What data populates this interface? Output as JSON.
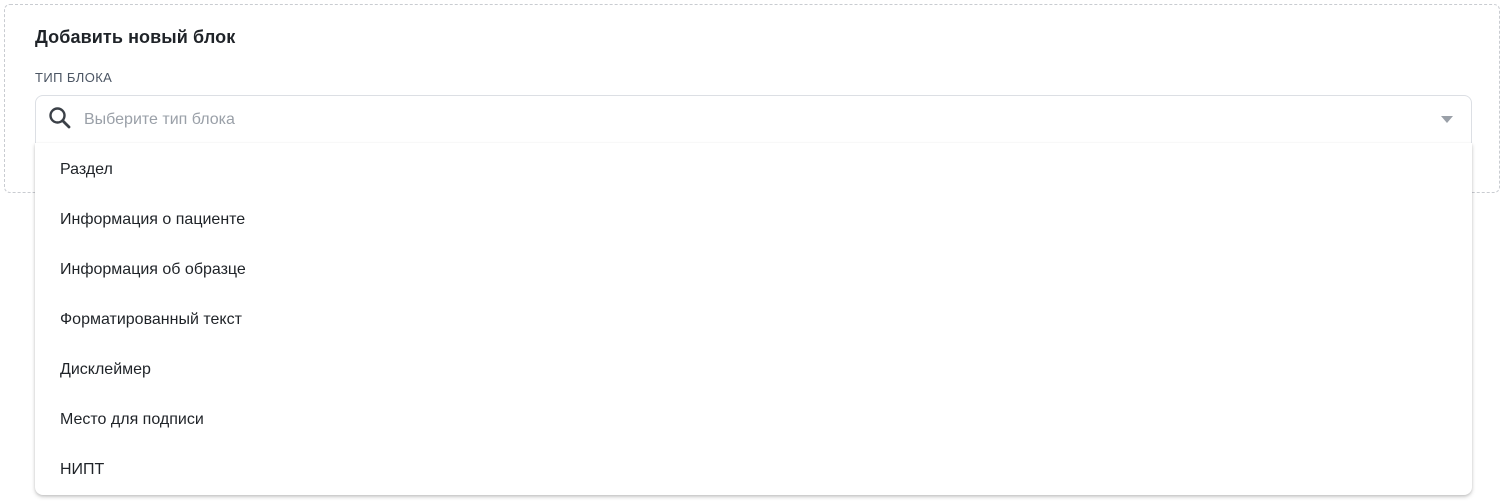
{
  "panel": {
    "title": "Добавить новый блок",
    "field_label": "ТИП БЛОКА"
  },
  "select": {
    "placeholder": "Выберите тип блока",
    "value": "",
    "search_icon": "search-icon",
    "chevron_icon": "chevron-down-icon"
  },
  "options": [
    "Раздел",
    "Информация о пациенте",
    "Информация об образце",
    "Форматированный текст",
    "Дисклеймер",
    "Место для подписи",
    "НИПТ"
  ],
  "colors": {
    "text": "#1f2328",
    "placeholder": "#9aa0a8",
    "border": "#dcdfe4",
    "dashed_border": "#c9ccd1"
  }
}
